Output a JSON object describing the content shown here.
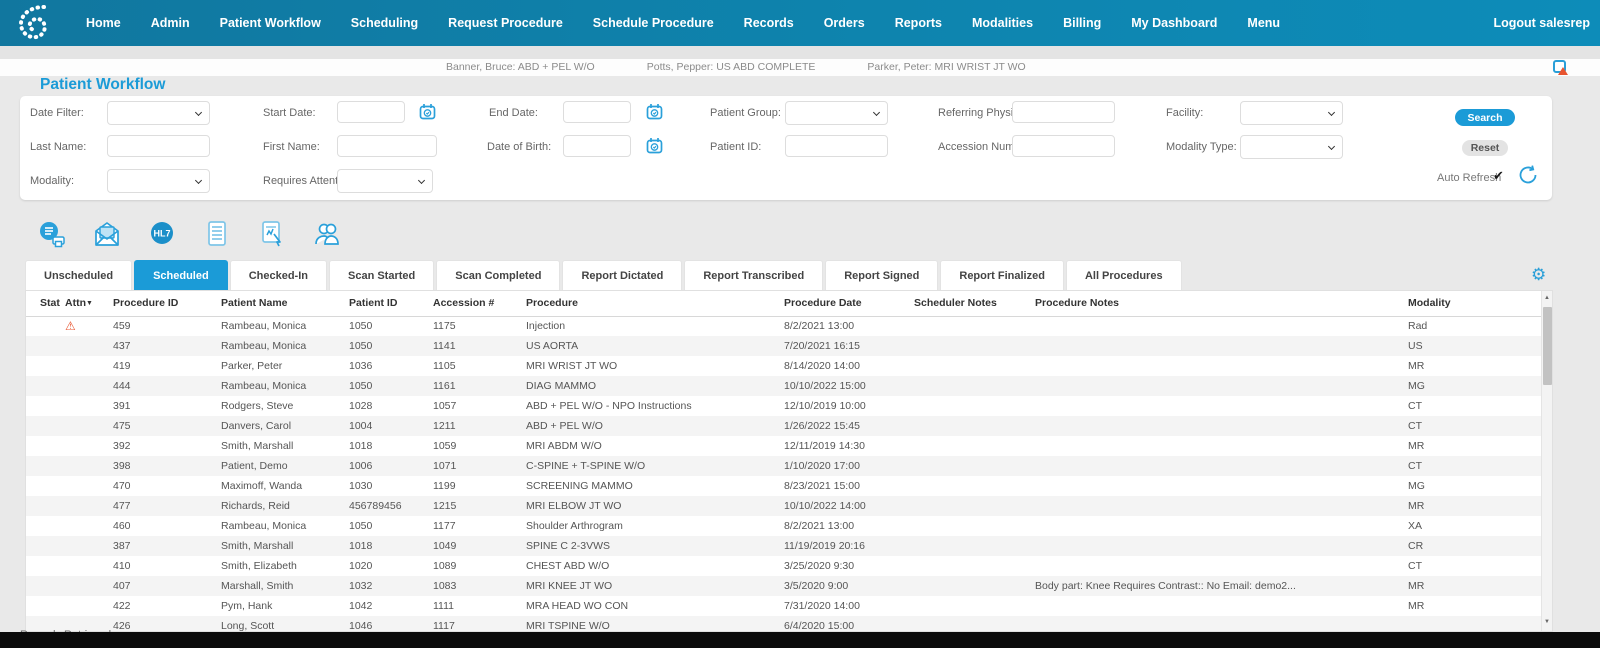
{
  "nav": {
    "items": [
      "Home",
      "Admin",
      "Patient Workflow",
      "Scheduling",
      "Request Procedure",
      "Schedule Procedure",
      "Records",
      "Orders",
      "Reports",
      "Modalities",
      "Billing",
      "My Dashboard",
      "Menu"
    ],
    "logout_label": "Logout salesrep"
  },
  "ticker": {
    "items": [
      "Banner, Bruce: ABD + PEL W/O",
      "Potts, Pepper: US ABD COMPLETE",
      "Parker, Peter: MRI WRIST JT WO"
    ]
  },
  "page": {
    "title": "Patient Workflow"
  },
  "filters": {
    "date_filter": "Date Filter:",
    "start_date": "Start Date:",
    "end_date": "End Date:",
    "patient_group": "Patient Group:",
    "referring_physician": "Referring Physician:",
    "facility": "Facility:",
    "last_name": "Last Name:",
    "first_name": "First Name:",
    "date_of_birth": "Date of Birth:",
    "patient_id": "Patient ID:",
    "accession_number": "Accession Number:",
    "modality_type": "Modality Type:",
    "modality": "Modality:",
    "requires_attention": "Requires Attention:",
    "search_label": "Search",
    "reset_label": "Reset",
    "auto_refresh_label": "Auto Refresh",
    "auto_refresh_checked": true
  },
  "toolbar_icons": [
    "print-report-icon",
    "email-icon",
    "hl7-icon",
    "order-notes-icon",
    "sign-report-icon",
    "patients-icon"
  ],
  "tabs": [
    {
      "label": "Unscheduled",
      "active": false
    },
    {
      "label": "Scheduled",
      "active": true
    },
    {
      "label": "Checked-In",
      "active": false
    },
    {
      "label": "Scan Started",
      "active": false
    },
    {
      "label": "Scan Completed",
      "active": false
    },
    {
      "label": "Report Dictated",
      "active": false
    },
    {
      "label": "Report Transcribed",
      "active": false
    },
    {
      "label": "Report Signed",
      "active": false
    },
    {
      "label": "Report Finalized",
      "active": false
    },
    {
      "label": "All Procedures",
      "active": false
    }
  ],
  "table": {
    "columns": {
      "stat": "Stat",
      "attn": "Attn",
      "procedure_id": "Procedure ID",
      "patient_name": "Patient Name",
      "patient_id": "Patient ID",
      "accession": "Accession #",
      "procedure": "Procedure",
      "procedure_date": "Procedure Date",
      "scheduler_notes": "Scheduler Notes",
      "procedure_notes": "Procedure Notes",
      "modality": "Modality"
    },
    "rows": [
      {
        "attn": true,
        "procedure_id": "459",
        "patient_name": "Rambeau, Monica",
        "patient_id": "1050",
        "accession": "1175",
        "procedure": "Injection",
        "procedure_date": "8/2/2021 13:00",
        "scheduler_notes": "",
        "procedure_notes": "",
        "modality": "Rad"
      },
      {
        "attn": false,
        "procedure_id": "437",
        "patient_name": "Rambeau, Monica",
        "patient_id": "1050",
        "accession": "1141",
        "procedure": "US AORTA",
        "procedure_date": "7/20/2021 16:15",
        "scheduler_notes": "",
        "procedure_notes": "",
        "modality": "US"
      },
      {
        "attn": false,
        "procedure_id": "419",
        "patient_name": "Parker, Peter",
        "patient_id": "1036",
        "accession": "1105",
        "procedure": "MRI WRIST JT WO",
        "procedure_date": "8/14/2020 14:00",
        "scheduler_notes": "",
        "procedure_notes": "",
        "modality": "MR"
      },
      {
        "attn": false,
        "procedure_id": "444",
        "patient_name": "Rambeau, Monica",
        "patient_id": "1050",
        "accession": "1161",
        "procedure": "DIAG MAMMO",
        "procedure_date": "10/10/2022 15:00",
        "scheduler_notes": "",
        "procedure_notes": "",
        "modality": "MG"
      },
      {
        "attn": false,
        "procedure_id": "391",
        "patient_name": "Rodgers, Steve",
        "patient_id": "1028",
        "accession": "1057",
        "procedure": "ABD + PEL W/O - NPO Instructions",
        "procedure_date": "12/10/2019 10:00",
        "scheduler_notes": "",
        "procedure_notes": "",
        "modality": "CT"
      },
      {
        "attn": false,
        "procedure_id": "475",
        "patient_name": "Danvers, Carol",
        "patient_id": "1004",
        "accession": "1211",
        "procedure": "ABD + PEL W/O",
        "procedure_date": "1/26/2022 15:45",
        "scheduler_notes": "",
        "procedure_notes": "",
        "modality": "CT"
      },
      {
        "attn": false,
        "procedure_id": "392",
        "patient_name": "Smith, Marshall",
        "patient_id": "1018",
        "accession": "1059",
        "procedure": "MRI ABDM W/O",
        "procedure_date": "12/11/2019 14:30",
        "scheduler_notes": "",
        "procedure_notes": "",
        "modality": "MR"
      },
      {
        "attn": false,
        "procedure_id": "398",
        "patient_name": "Patient, Demo",
        "patient_id": "1006",
        "accession": "1071",
        "procedure": "C-SPINE + T-SPINE W/O",
        "procedure_date": "1/10/2020 17:00",
        "scheduler_notes": "",
        "procedure_notes": "",
        "modality": "CT"
      },
      {
        "attn": false,
        "procedure_id": "470",
        "patient_name": "Maximoff, Wanda",
        "patient_id": "1030",
        "accession": "1199",
        "procedure": "SCREENING MAMMO",
        "procedure_date": "8/23/2021 15:00",
        "scheduler_notes": "",
        "procedure_notes": "",
        "modality": "MG"
      },
      {
        "attn": false,
        "procedure_id": "477",
        "patient_name": "Richards, Reid",
        "patient_id": "456789456",
        "accession": "1215",
        "procedure": "MRI ELBOW JT WO",
        "procedure_date": "10/10/2022 14:00",
        "scheduler_notes": "",
        "procedure_notes": "",
        "modality": "MR"
      },
      {
        "attn": false,
        "procedure_id": "460",
        "patient_name": "Rambeau, Monica",
        "patient_id": "1050",
        "accession": "1177",
        "procedure": "Shoulder Arthrogram",
        "procedure_date": "8/2/2021 13:00",
        "scheduler_notes": "",
        "procedure_notes": "",
        "modality": "XA"
      },
      {
        "attn": false,
        "procedure_id": "387",
        "patient_name": "Smith, Marshall",
        "patient_id": "1018",
        "accession": "1049",
        "procedure": "SPINE C 2-3VWS",
        "procedure_date": "11/19/2019 20:16",
        "scheduler_notes": "",
        "procedure_notes": "",
        "modality": "CR"
      },
      {
        "attn": false,
        "procedure_id": "410",
        "patient_name": "Smith, Elizabeth",
        "patient_id": "1020",
        "accession": "1089",
        "procedure": "CHEST ABD W/O",
        "procedure_date": "3/25/2020 9:30",
        "scheduler_notes": "",
        "procedure_notes": "",
        "modality": "CT"
      },
      {
        "attn": false,
        "procedure_id": "407",
        "patient_name": "Marshall, Smith",
        "patient_id": "1032",
        "accession": "1083",
        "procedure": "MRI KNEE JT WO",
        "procedure_date": "3/5/2020 9:00",
        "scheduler_notes": "",
        "procedure_notes": "Body part: Knee Requires Contrast:: No Email: demo2...",
        "modality": "MR"
      },
      {
        "attn": false,
        "procedure_id": "422",
        "patient_name": "Pym, Hank",
        "patient_id": "1042",
        "accession": "1111",
        "procedure": "MRA HEAD WO CON",
        "procedure_date": "7/31/2020 14:00",
        "scheduler_notes": "",
        "procedure_notes": "",
        "modality": "MR"
      },
      {
        "attn": false,
        "procedure_id": "426",
        "patient_name": "Long, Scott",
        "patient_id": "1046",
        "accession": "1117",
        "procedure": "MRI TSPINE W/O",
        "procedure_date": "6/4/2020 15:00",
        "scheduler_notes": "",
        "procedure_notes": "",
        "modality": ""
      }
    ]
  },
  "footer": {
    "records_text": "Records Retrieved"
  },
  "colors": {
    "accent": "#1b9bd7",
    "nav": "#0e84ae",
    "warning": "#e8542f"
  }
}
